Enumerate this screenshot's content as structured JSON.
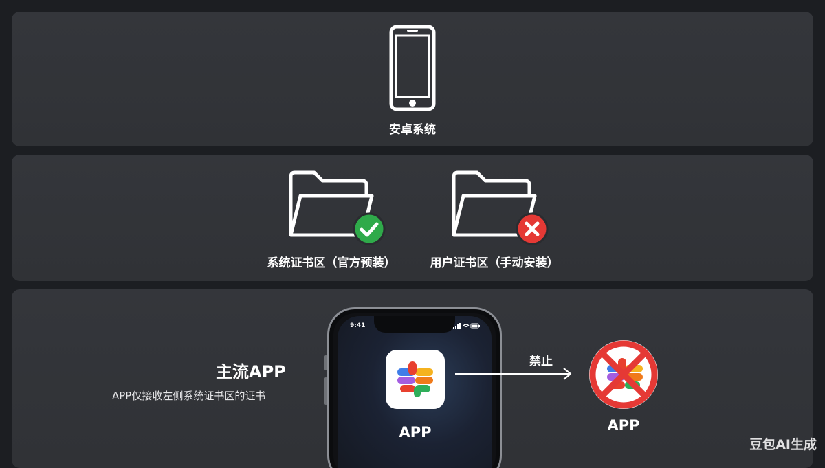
{
  "top": {
    "title": "安卓系统",
    "icon": "smartphone-icon"
  },
  "stores": [
    {
      "label": "系统证书区（官方预装）",
      "icon": "folder-icon",
      "status": "allowed",
      "badge_icon": "check-icon",
      "badge_color": "#2faa4a"
    },
    {
      "label": "用户证书区（手动安装）",
      "icon": "folder-icon",
      "status": "blocked",
      "badge_icon": "close-icon",
      "badge_color": "#e53935"
    }
  ],
  "mainstream": {
    "title": "主流APP",
    "description": "APP仅接收左侧系统证书区的证书"
  },
  "phone": {
    "time": "9:41",
    "app_label": "APP"
  },
  "flow": {
    "arrow_label": "禁止",
    "blocked_app_label": "APP",
    "prohibit_color": "#e53935"
  },
  "watermark": "豆包AI生成"
}
